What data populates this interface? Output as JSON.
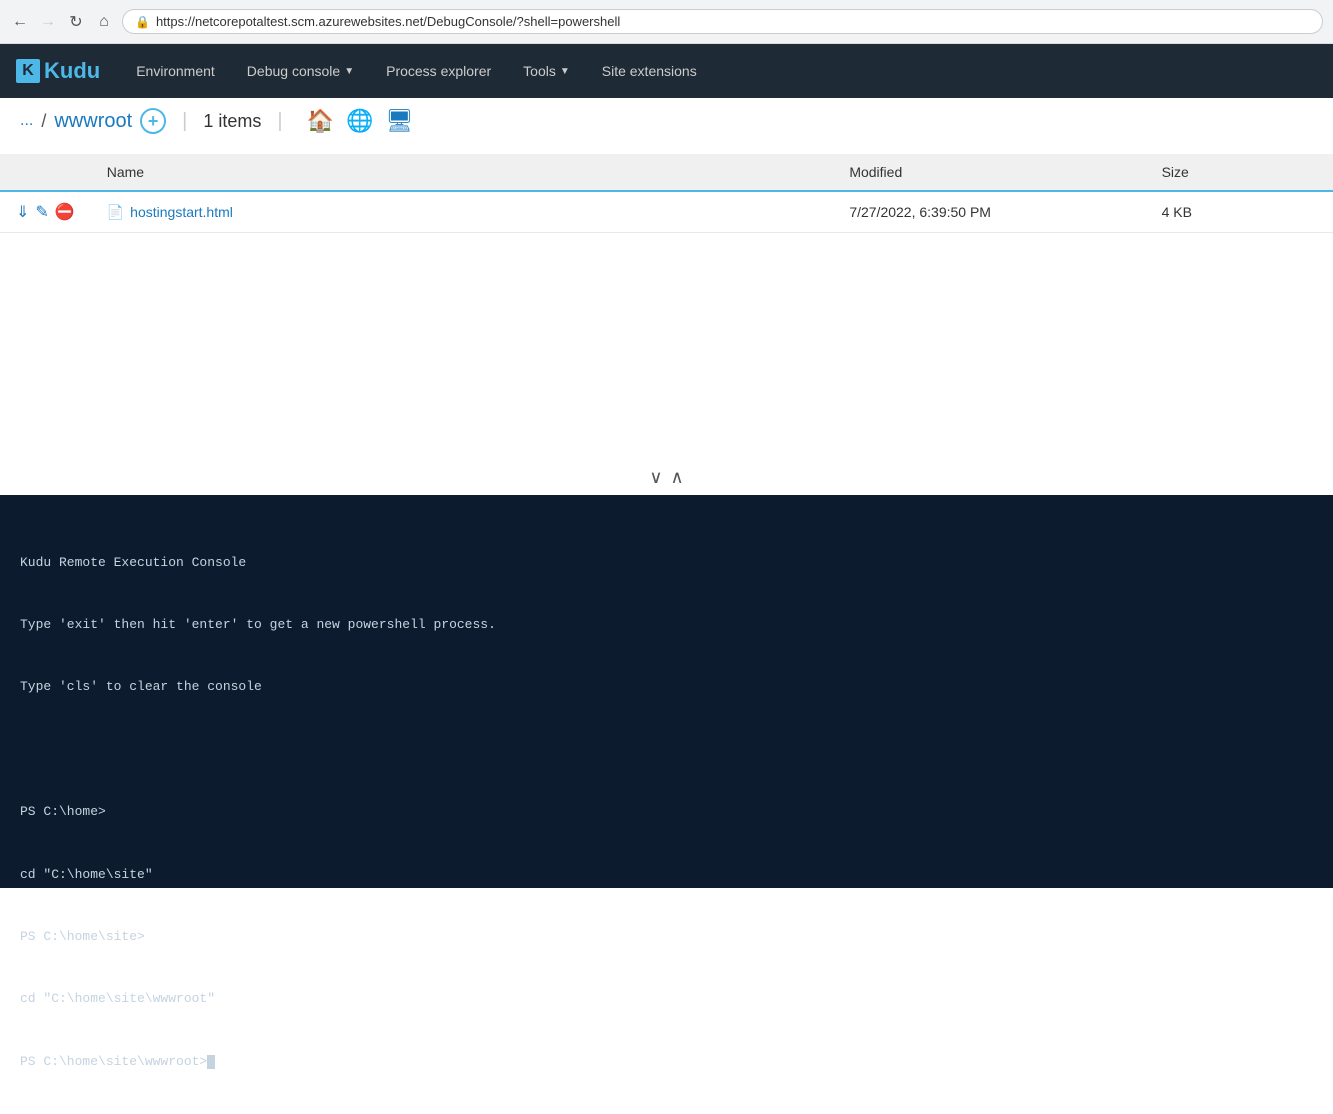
{
  "browser": {
    "url": "https://netcorepotaltest.scm.azurewebsites.net/DebugConsole/?shell=powershell",
    "back_disabled": false,
    "forward_disabled": true
  },
  "navbar": {
    "brand": "Kudu",
    "items": [
      {
        "label": "Environment",
        "has_dropdown": false
      },
      {
        "label": "Debug console",
        "has_dropdown": true
      },
      {
        "label": "Process explorer",
        "has_dropdown": false
      },
      {
        "label": "Tools",
        "has_dropdown": true
      },
      {
        "label": "Site extensions",
        "has_dropdown": false
      }
    ]
  },
  "path_bar": {
    "dots": "...",
    "separator": "/",
    "folder": "wwwroot",
    "add_label": "+",
    "items_count": "1 items"
  },
  "file_table": {
    "headers": [
      "",
      "Name",
      "Modified",
      "Size"
    ],
    "rows": [
      {
        "name": "hostingstart.html",
        "modified": "7/27/2022, 6:39:50 PM",
        "size": "4 KB"
      }
    ]
  },
  "resize": {
    "down_arrow": "∨",
    "up_arrow": "∧"
  },
  "terminal": {
    "lines": [
      "Kudu Remote Execution Console",
      "Type 'exit' then hit 'enter' to get a new powershell process.",
      "Type 'cls' to clear the console",
      "",
      "PS C:\\home>",
      "cd \"C:\\home\\site\"",
      "PS C:\\home\\site>",
      "cd \"C:\\home\\site\\wwwroot\"",
      "PS C:\\home\\site\\wwwroot>"
    ]
  }
}
